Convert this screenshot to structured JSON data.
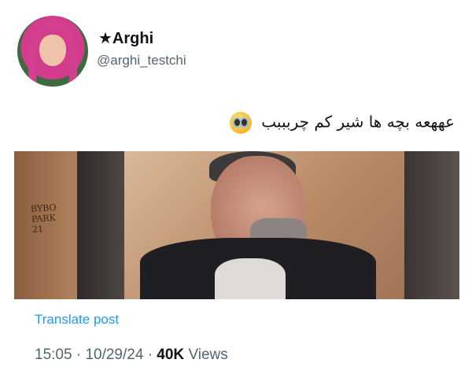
{
  "user": {
    "display_name": "★Arghi",
    "handle": "@arghi_testchi"
  },
  "post": {
    "text": "عههعه بچه ها شیر کم چربببب",
    "emoji": "pleading-face-emoji",
    "media_sign_text": "BYBO\nPARK\n21"
  },
  "footer": {
    "translate_label": "Translate post",
    "time": "15:05",
    "date": "10/29/24",
    "separator": "·",
    "views_count": "40K",
    "views_label": "Views"
  },
  "colors": {
    "link": "#1d9bf0",
    "muted": "#536471",
    "text": "#0f1419"
  }
}
